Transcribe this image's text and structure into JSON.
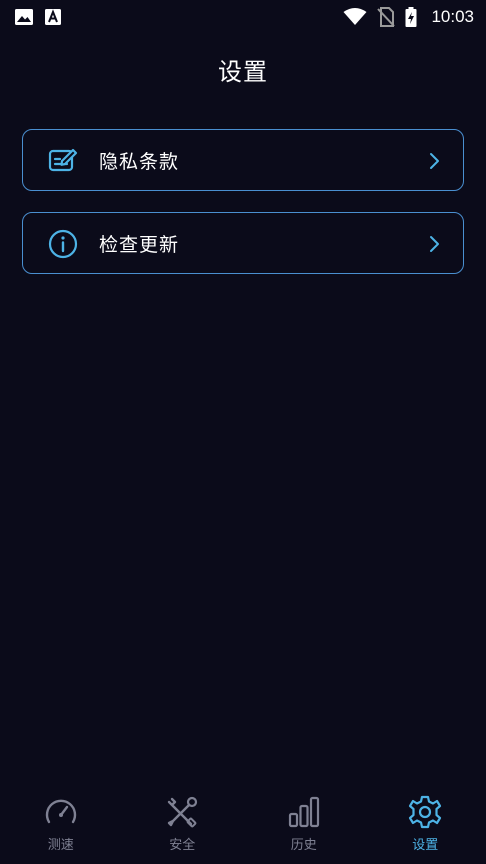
{
  "status_bar": {
    "time": "10:03",
    "icons": [
      "image-icon",
      "accessibility-icon",
      "wifi-icon",
      "no-sim-icon",
      "battery-charging-icon"
    ]
  },
  "header": {
    "title": "设置"
  },
  "menu": {
    "items": [
      {
        "label": "隐私条款",
        "icon": "edit-document-icon"
      },
      {
        "label": "检查更新",
        "icon": "info-icon"
      }
    ]
  },
  "bottom_nav": {
    "tabs": [
      {
        "label": "测速",
        "icon": "speedometer-icon",
        "active": false
      },
      {
        "label": "安全",
        "icon": "tools-icon",
        "active": false
      },
      {
        "label": "历史",
        "icon": "bar-chart-icon",
        "active": false
      },
      {
        "label": "设置",
        "icon": "gear-icon",
        "active": true
      }
    ]
  },
  "colors": {
    "background": "#0b0b1a",
    "accent": "#4db3e6",
    "border": "#4a8fd0",
    "inactive": "#7f8193"
  }
}
